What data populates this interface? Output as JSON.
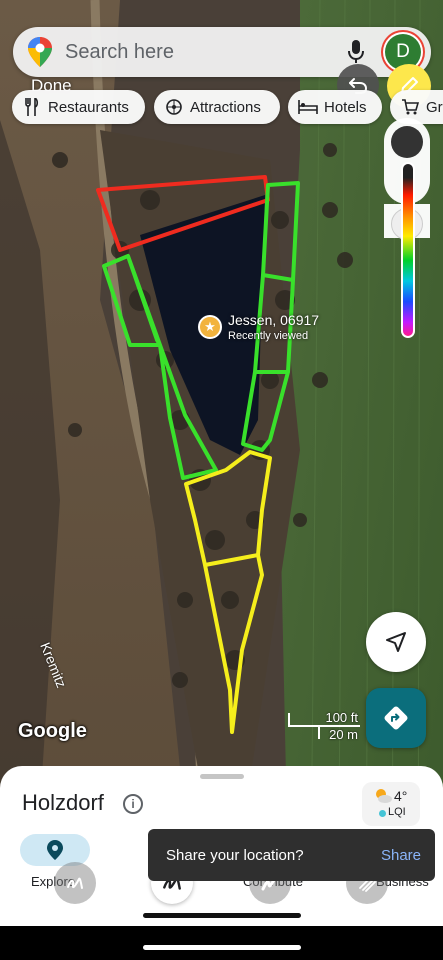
{
  "search": {
    "placeholder": "Search here",
    "avatar_letter": "D"
  },
  "drawing": {
    "done_label": "Done"
  },
  "chips": [
    {
      "icon": "fork-knife-icon",
      "label": "Restaurants"
    },
    {
      "icon": "attractions-icon",
      "label": "Attractions"
    },
    {
      "icon": "bed-icon",
      "label": "Hotels"
    },
    {
      "icon": "cart-icon",
      "label": "Gr"
    }
  ],
  "map": {
    "place_title": "Jessen, 06917",
    "place_subtitle": "Recently viewed",
    "river_label": "Kremitz",
    "logo": "Google",
    "scale_ft": "100 ft",
    "scale_m": "20 m",
    "stroke_colors": {
      "red": "#ef2b1f",
      "green": "#39e02b",
      "yellow": "#f5ee1c"
    }
  },
  "sheet": {
    "region": "Holzdorf",
    "weather_temp": "4°",
    "weather_aqi": "LQI"
  },
  "nav": {
    "explore": "Explore",
    "contribute": "Contribute",
    "business": "Business"
  },
  "toast": {
    "message": "Share your location?",
    "action": "Share"
  },
  "colors": {
    "accent": "#0b6e7c",
    "pen": "#fde74c"
  }
}
